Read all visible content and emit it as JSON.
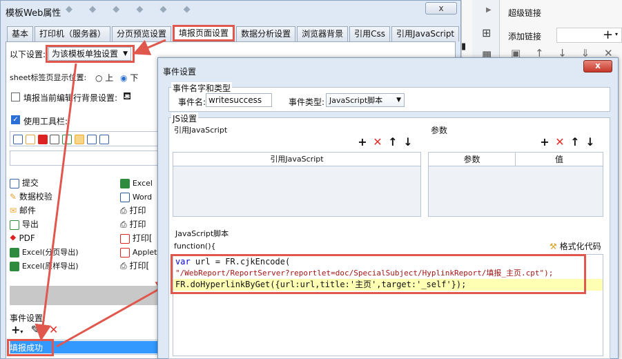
{
  "main_window": {
    "title": "模板Web属性",
    "close_label": "x",
    "tabs": [
      "基本",
      "打印机（服务器）",
      "分页预览设置",
      "填报页面设置",
      "数据分析设置",
      "浏览器背景",
      "引用Css",
      "引用JavaScript"
    ],
    "active_tab": "填报页面设置",
    "settings_label": "以下设置:",
    "settings_value": "为该模板单独设置",
    "sheet_tab_label": "sheet标签页显示位置:",
    "radio_top": "上",
    "radio_bottom": "下",
    "radio_selected": "下",
    "bg_checkbox_label": "填报当前编辑行背景设置:",
    "toolbar_checkbox_label": "使用工具栏:",
    "toolbar_items_left": [
      {
        "label": "提交",
        "color": "#3b5ea8"
      },
      {
        "label": "数据校验",
        "color": "#e0a23a"
      },
      {
        "label": "邮件",
        "color": "#f0a830"
      },
      {
        "label": "导出",
        "color": "#2e8b3d"
      },
      {
        "label": "PDF",
        "color": "#d22"
      },
      {
        "label": "Excel(分页导出)",
        "color": "#2e8b3d"
      },
      {
        "label": "Excel(原样导出)",
        "color": "#2e8b3d"
      }
    ],
    "toolbar_items_right": [
      {
        "label": "Excel",
        "color": "#2e8b3d"
      },
      {
        "label": "Word",
        "color": "#2b579a"
      },
      {
        "label": "打印",
        "color": "#555"
      },
      {
        "label": "打印",
        "color": "#555"
      },
      {
        "label": "打印[",
        "color": "#d22"
      },
      {
        "label": "Applet",
        "color": "#d22"
      },
      {
        "label": "打印[",
        "color": "#555"
      }
    ],
    "event_settings_label": "事件设置:",
    "event_selected": "填报成功"
  },
  "right_panel": {
    "title": "超级链接",
    "add_link_label": "添加链接"
  },
  "dialog": {
    "title": "事件设置",
    "close_label": "x",
    "name_type_group": "事件名字和类型",
    "event_name_label": "事件名:",
    "event_name_value": "writesuccess",
    "event_type_label": "事件类型:",
    "event_type_value": "JavaScript脚本",
    "js_group": "JS设置",
    "ref_js_label": "引用JavaScript",
    "params_label": "参数",
    "ref_js_column": "引用JavaScript",
    "params_col": "参数",
    "value_col": "值",
    "script_label": "JavaScript脚本",
    "func_header": "function(){",
    "format_label": "格式化代码",
    "code_lines": [
      "var url = FR.cjkEncode(",
      "\"/WebReport/ReportServer?reportlet=doc/SpecialSubject/HyplinkReport/填报_主页.cpt\");",
      "FR.doHyperlinkByGet({url:url,title:'主页',target:'_self'});"
    ]
  },
  "colors": {
    "accent_red": "#e0574d",
    "selection_blue": "#3399ff",
    "highlight_line": "#ffffb3"
  }
}
